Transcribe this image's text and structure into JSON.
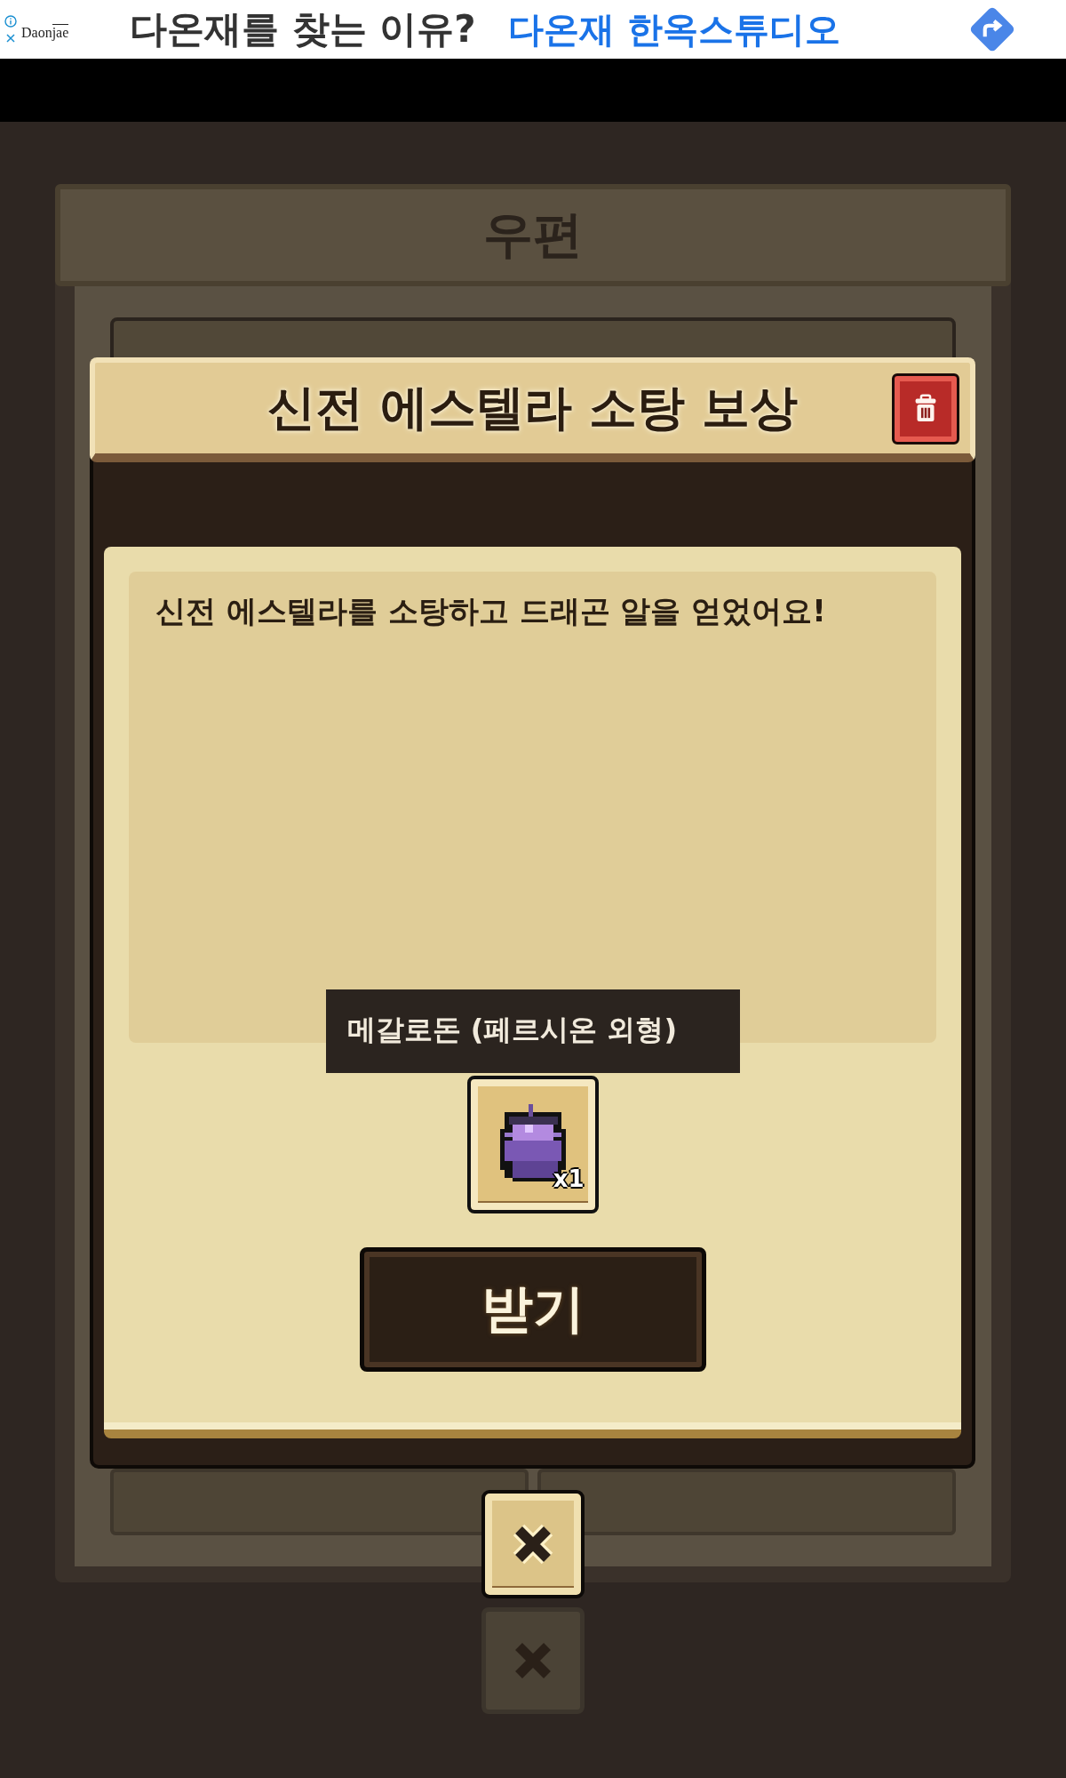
{
  "ad": {
    "logo": [
      "Daon",
      "jae"
    ],
    "headline": "다온재를 찾는 이유?",
    "link": "다온재 한옥스튜디오"
  },
  "mail": {
    "title": "우편"
  },
  "dialog": {
    "title": "신전 에스텔라 소탕 보상",
    "message": "신전 에스텔라를 소탕하고 드래곤 알을 얻었어요!",
    "reward": {
      "name": "메갈로돈 (페르시온 외형)",
      "quantity": "x1"
    },
    "button": "받기"
  }
}
